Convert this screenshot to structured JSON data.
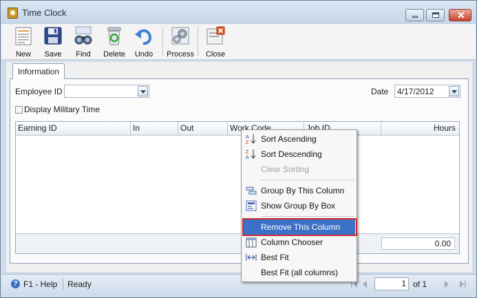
{
  "window": {
    "title": "Time Clock"
  },
  "toolbar": {
    "new": "New",
    "save": "Save",
    "find": "Find",
    "delete": "Delete",
    "undo": "Undo",
    "process": "Process",
    "close": "Close"
  },
  "tabs": {
    "information": "Information"
  },
  "form": {
    "employee_id_label": "Employee ID",
    "employee_id_value": "",
    "date_label": "Date",
    "date_value": "4/17/2012",
    "military_time_label": "Display Military Time",
    "military_time_checked": false
  },
  "grid": {
    "columns": [
      "Earning ID",
      "In",
      "Out",
      "Work Code",
      "Job ID",
      "Hours"
    ],
    "rows": [],
    "total_hours": "0.00"
  },
  "context_menu": {
    "items": [
      {
        "label": "Sort Ascending",
        "icon": "sort-ascending-icon",
        "enabled": true
      },
      {
        "label": "Sort Descending",
        "icon": "sort-descending-icon",
        "enabled": true
      },
      {
        "label": "Clear Sorting",
        "icon": "",
        "enabled": false
      },
      {
        "label": "Group By This Column",
        "icon": "group-by-column-icon",
        "enabled": true
      },
      {
        "label": "Show Group By Box",
        "icon": "group-by-box-icon",
        "enabled": true
      },
      {
        "label": "Remove This Column",
        "icon": "",
        "enabled": true,
        "highlighted": true
      },
      {
        "label": "Column Chooser",
        "icon": "column-chooser-icon",
        "enabled": true
      },
      {
        "label": "Best Fit",
        "icon": "best-fit-icon",
        "enabled": true
      },
      {
        "label": "Best Fit (all columns)",
        "icon": "",
        "enabled": true
      }
    ]
  },
  "statusbar": {
    "help": "F1 - Help",
    "status": "Ready",
    "page_current": "1",
    "page_of": "of 1"
  },
  "colors": {
    "highlight": "#3b72c6",
    "outline": "#d22a2a",
    "chrome": "#cfdcec"
  }
}
